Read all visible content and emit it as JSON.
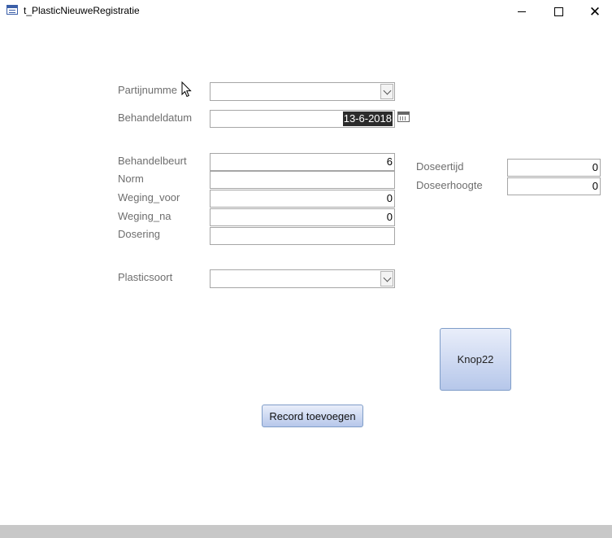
{
  "window": {
    "title": "t_PlasticNieuweRegistratie"
  },
  "form": {
    "partijnummer": {
      "label": "Partijnumme",
      "value": ""
    },
    "behandeldatum": {
      "label": "Behandeldatum",
      "value": "13-6-2018"
    },
    "behandelbeurt": {
      "label": "Behandelbeurt",
      "value": "6"
    },
    "norm": {
      "label": "Norm",
      "value": ""
    },
    "weging_voor": {
      "label": "Weging_voor",
      "value": "0"
    },
    "weging_na": {
      "label": "Weging_na",
      "value": "0"
    },
    "dosering": {
      "label": "Dosering",
      "value": ""
    },
    "plasticsoort": {
      "label": "Plasticsoort",
      "value": ""
    },
    "doseertijd": {
      "label": "Doseertijd",
      "value": "0"
    },
    "doseerhoogte": {
      "label": "Doseerhoogte",
      "value": "0"
    }
  },
  "buttons": {
    "knop22": "Knop22",
    "record_toevoegen": "Record toevoegen"
  },
  "colors": {
    "label": "#6e6e6e",
    "field_border": "#a6a6a6",
    "button_gradient_top": "#e9eefa",
    "button_gradient_bottom": "#b6c7ea",
    "button_border": "#7f9dc8"
  }
}
